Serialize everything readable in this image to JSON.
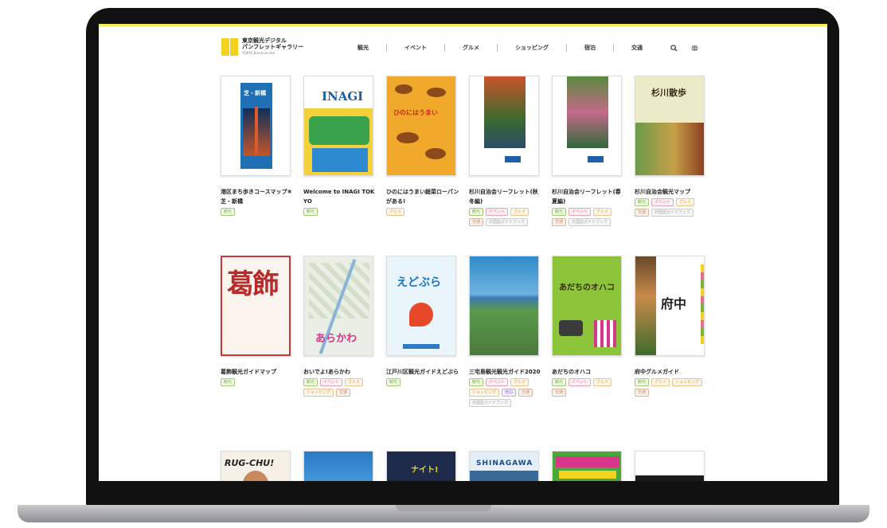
{
  "site": {
    "title_line1": "東京観光デジタル",
    "title_line2": "パンフレットギャラリー",
    "url": "TOKYO Brochure site"
  },
  "nav": [
    "観光",
    "イベント",
    "グルメ",
    "ショッピング",
    "宿泊",
    "交通"
  ],
  "icons": {
    "search": "search-icon",
    "globe": "globe-icon"
  },
  "colors": {
    "accent": "#f2d21c",
    "tag_kanko": "#7ab53b",
    "tag_event": "#e06f8c",
    "tag_gourmet": "#e9a23a"
  },
  "cards": [
    {
      "title": "港区まち歩きコースマップ⑧ 芝・新橋",
      "tags": [
        "観光"
      ],
      "cover_text": "芝・新橋"
    },
    {
      "title": "Welcome to INAGI TOKYO",
      "tags": [
        "観光"
      ],
      "cover_text": "INAGI"
    },
    {
      "title": "ひのにはうまい総菜ローパンがある!",
      "tags": [
        "グルメ"
      ],
      "cover_text": "ひのにはうまい"
    },
    {
      "title": "杉川自治会リーフレット(秋冬編)",
      "tags": [
        "観光",
        "イベント",
        "グルメ",
        "交通",
        "外国語ガイドブック"
      ],
      "cover_text": ""
    },
    {
      "title": "杉川自治会リーフレット(春夏編)",
      "tags": [
        "観光",
        "イベント",
        "グルメ",
        "交通",
        "外国語ガイドブック"
      ],
      "cover_text": ""
    },
    {
      "title": "杉川自治会観光マップ",
      "tags": [
        "観光",
        "イベント",
        "グルメ",
        "交通",
        "外国語ガイドブック"
      ],
      "cover_text": "杉川散歩"
    },
    {
      "title": "葛飾観光ガイドマップ",
      "tags": [
        "観光"
      ],
      "cover_text": "葛飾"
    },
    {
      "title": "おいでよ!あらかわ",
      "tags": [
        "観光",
        "イベント",
        "グルメ",
        "ショッピング",
        "交通"
      ],
      "cover_text": "あらかわ"
    },
    {
      "title": "江戸川区観光ガイドえどぶら",
      "tags": [
        "観光"
      ],
      "cover_text": "えどぶら"
    },
    {
      "title": "三宅島観光観光ガイド2020",
      "tags": [
        "観光",
        "イベント",
        "グルメ",
        "ショッピング",
        "宿泊",
        "交通",
        "外国語ガイドブック"
      ],
      "cover_text": ""
    },
    {
      "title": "あだちのオハコ",
      "tags": [
        "観光",
        "イベント",
        "グルメ",
        "交通"
      ],
      "cover_text": "あだちのオハコ"
    },
    {
      "title": "府中グルメガイド",
      "tags": [
        "観光",
        "グルメ",
        "ショッピング",
        "交通"
      ],
      "cover_text": "府中"
    },
    {
      "title": "",
      "tags": [],
      "cover_text": "RUG-CHU!"
    },
    {
      "title": "",
      "tags": [],
      "cover_text": ""
    },
    {
      "title": "",
      "tags": [],
      "cover_text": "ナイト!"
    },
    {
      "title": "",
      "tags": [],
      "cover_text": "SHINAGAWA"
    },
    {
      "title": "",
      "tags": [],
      "cover_text": ""
    },
    {
      "title": "",
      "tags": [],
      "cover_text": ""
    }
  ]
}
